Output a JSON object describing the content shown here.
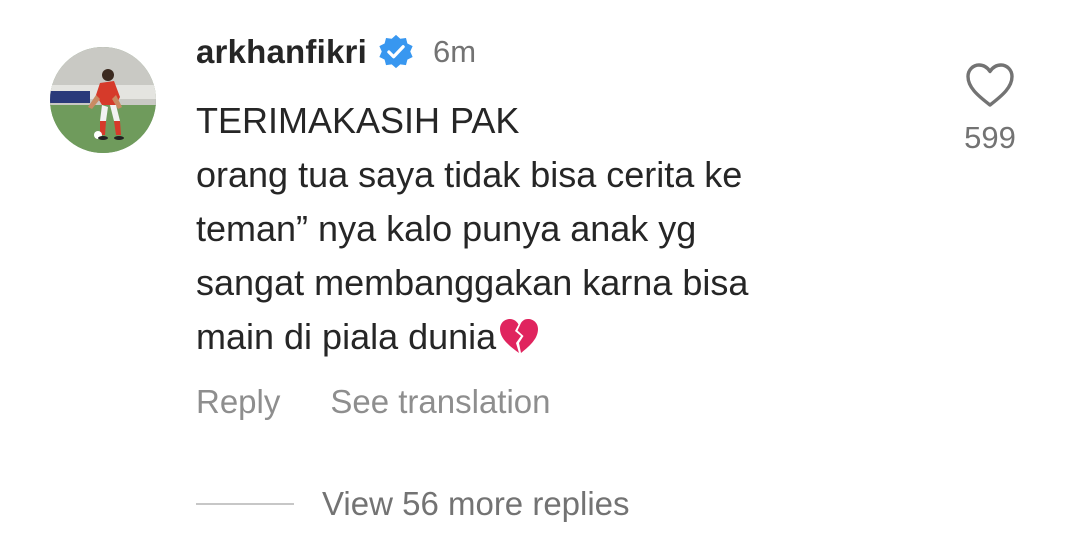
{
  "comment": {
    "username": "arkhanfikri",
    "verified_icon": "verified-badge-icon",
    "time": "6m",
    "lines": [
      "TERIMAKASIH PAK",
      "orang tua saya tidak bisa cerita ke",
      "teman” nya kalo punya anak yg",
      "sangat membanggakan karna bisa",
      "main di piala dunia"
    ],
    "emoji": "💔",
    "like_count": "599",
    "actions": {
      "reply": "Reply",
      "translate": "See translation"
    },
    "view_more": "View 56 more replies"
  },
  "colors": {
    "verified": "#3897f0",
    "text": "#262626",
    "muted": "#737373",
    "emoji_heart": "#e0245e"
  }
}
